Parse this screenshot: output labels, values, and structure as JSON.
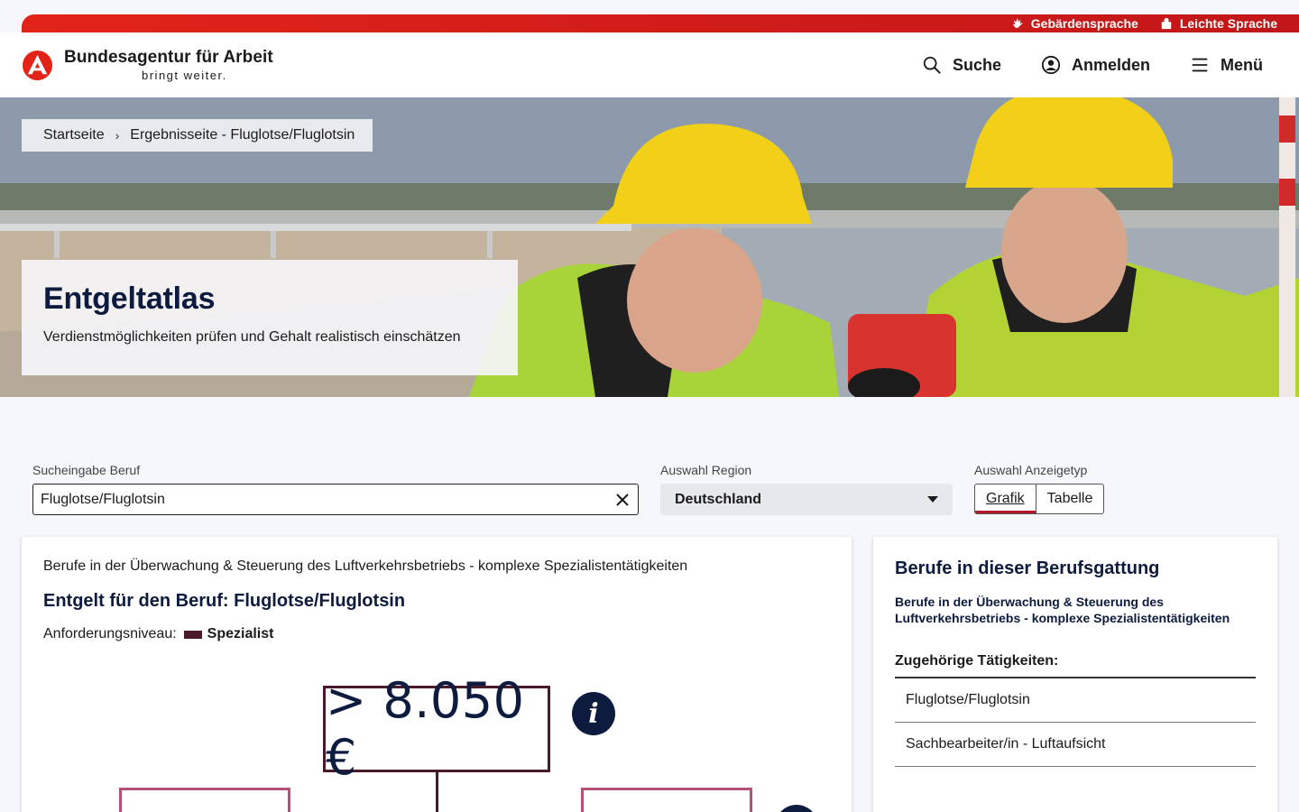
{
  "topbar": {
    "sign_language_label": "Gebärdensprache",
    "easy_language_label": "Leichte Sprache"
  },
  "brand": {
    "name": "Bundesagentur für Arbeit",
    "claim": "bringt weiter.",
    "color": "#e2231a"
  },
  "nav": {
    "search_label": "Suche",
    "login_label": "Anmelden",
    "menu_label": "Menü"
  },
  "breadcrumb": {
    "items": [
      "Startseite",
      "Ergebnisseite - Fluglotse/Fluglotsin"
    ],
    "separator": "›"
  },
  "hero": {
    "title": "Entgeltatlas",
    "subtitle": "Verdienstmöglichkeiten prüfen und Gehalt realistisch einschätzen"
  },
  "filters": {
    "job_label": "Sucheingabe Beruf",
    "job_value": "Fluglotse/Fluglotsin",
    "region_label": "Auswahl Region",
    "region_value": "Deutschland",
    "display_label": "Auswahl Anzeigetyp",
    "display_options": [
      "Grafik",
      "Tabelle"
    ],
    "display_selected": "Grafik"
  },
  "result": {
    "occupation_group": "Berufe in der Überwachung & Steuerung des Luftverkehrsbetriebs - komplexe Spezialistentätigkeiten",
    "title": "Entgelt für den Beruf: Fluglotse/Fluglotsin",
    "level_label": "Anforderungsniveau:",
    "level_value": "Spezialist",
    "level_color": "#4a1a2c",
    "median_value": "> 8.050 €",
    "info_glyph": "i"
  },
  "side": {
    "title": "Berufe in dieser Berufsgattung",
    "subtitle": "Berufe in der Überwachung & Steuerung des Luftverkehrsbetriebs - komplexe Spezialistentätigkeiten",
    "list_heading": "Zugehörige Tätigkeiten:",
    "items": [
      "Fluglotse/Fluglotsin",
      "Sachbearbeiter/in - Luftaufsicht"
    ]
  }
}
